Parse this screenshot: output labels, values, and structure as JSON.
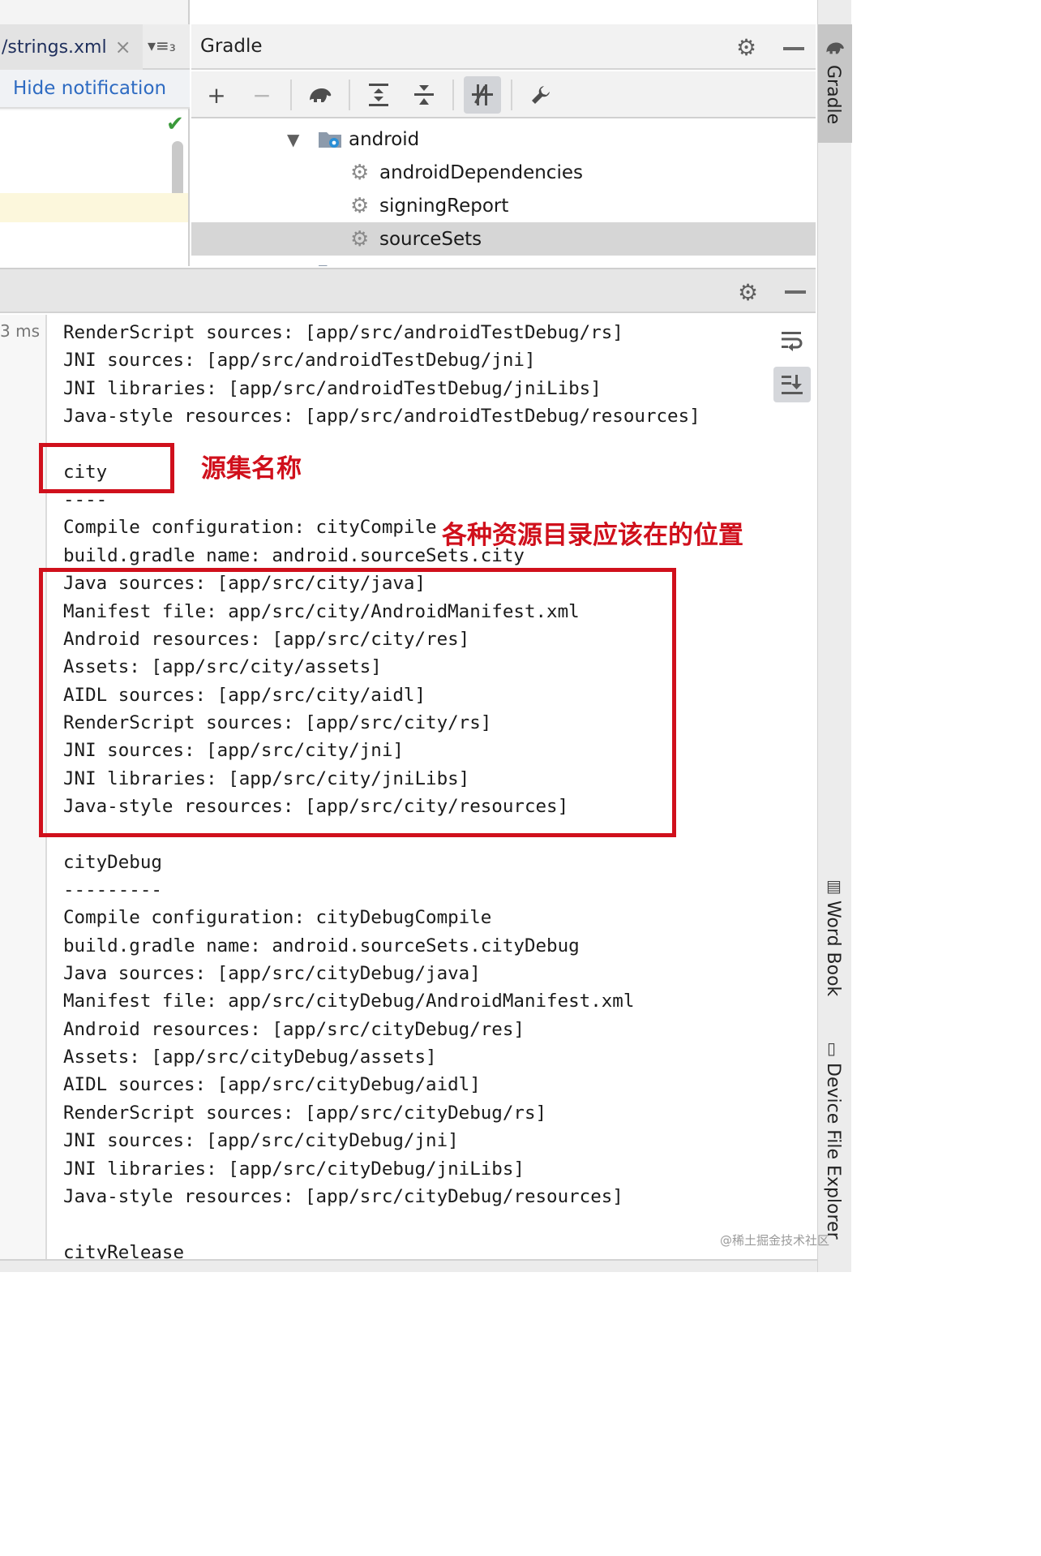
{
  "editor": {
    "file_tab": "/strings.xml",
    "tab_close": "×",
    "tab_menu": "▾≡₃",
    "hide_notification": "Hide notification",
    "check": "✔"
  },
  "gradle_panel": {
    "title": "Gradle",
    "tree": [
      {
        "label": "android",
        "kind": "project-folder",
        "expanded": true
      },
      {
        "label": "androidDependencies",
        "kind": "task"
      },
      {
        "label": "signingReport",
        "kind": "task"
      },
      {
        "label": "sourceSets",
        "kind": "task",
        "selected": true
      }
    ]
  },
  "right_stripe": {
    "gradle": "Gradle",
    "word_book": "Word Book",
    "device_file_explorer": "Device File Explorer"
  },
  "run_panel": {
    "time_label": "3 ms",
    "console_lines": [
      "RenderScript sources: [app/src/androidTestDebug/rs]",
      "JNI sources: [app/src/androidTestDebug/jni]",
      "JNI libraries: [app/src/androidTestDebug/jniLibs]",
      "Java-style resources: [app/src/androidTestDebug/resources]",
      "",
      "city",
      "----",
      "Compile configuration: cityCompile",
      "build.gradle name: android.sourceSets.city",
      "Java sources: [app/src/city/java]",
      "Manifest file: app/src/city/AndroidManifest.xml",
      "Android resources: [app/src/city/res]",
      "Assets: [app/src/city/assets]",
      "AIDL sources: [app/src/city/aidl]",
      "RenderScript sources: [app/src/city/rs]",
      "JNI sources: [app/src/city/jni]",
      "JNI libraries: [app/src/city/jniLibs]",
      "Java-style resources: [app/src/city/resources]",
      "",
      "cityDebug",
      "---------",
      "Compile configuration: cityDebugCompile",
      "build.gradle name: android.sourceSets.cityDebug",
      "Java sources: [app/src/cityDebug/java]",
      "Manifest file: app/src/cityDebug/AndroidManifest.xml",
      "Android resources: [app/src/cityDebug/res]",
      "Assets: [app/src/cityDebug/assets]",
      "AIDL sources: [app/src/cityDebug/aidl]",
      "RenderScript sources: [app/src/cityDebug/rs]",
      "JNI sources: [app/src/cityDebug/jni]",
      "JNI libraries: [app/src/cityDebug/jniLibs]",
      "Java-style resources: [app/src/cityDebug/resources]",
      "",
      "cityRelease"
    ]
  },
  "annotations": {
    "source_set_name": "源集名称",
    "resource_dirs": "各种资源目录应该在的位置",
    "color": "#d0101c"
  },
  "watermark": "@稀土掘金技术社区"
}
